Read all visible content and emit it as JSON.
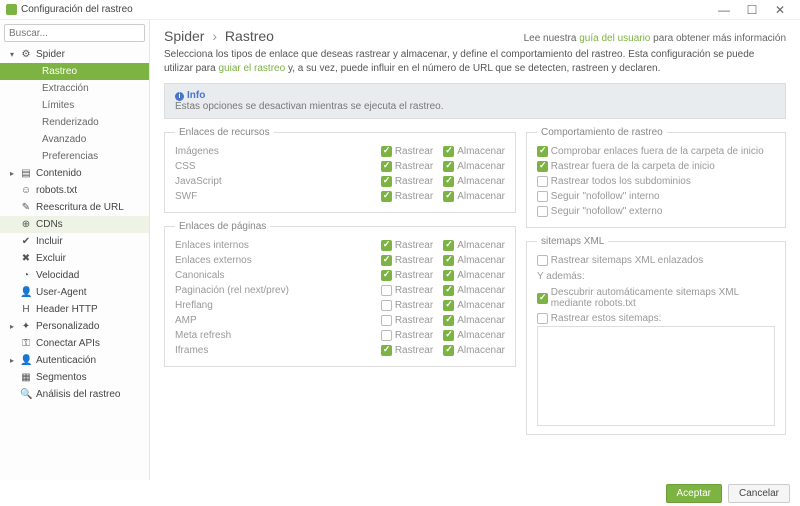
{
  "window": {
    "title": "Configuración del rastreo",
    "min": "—",
    "max": "☐",
    "close": "✕"
  },
  "search": {
    "placeholder": "Buscar..."
  },
  "sidebar": {
    "items": [
      {
        "label": "Spider"
      },
      {
        "label": "Rastreo"
      },
      {
        "label": "Extracción"
      },
      {
        "label": "Límites"
      },
      {
        "label": "Renderizado"
      },
      {
        "label": "Avanzado"
      },
      {
        "label": "Preferencias"
      },
      {
        "label": "Contenido"
      },
      {
        "label": "robots.txt"
      },
      {
        "label": "Reescritura de URL"
      },
      {
        "label": "CDNs"
      },
      {
        "label": "Incluir"
      },
      {
        "label": "Excluir"
      },
      {
        "label": "Velocidad"
      },
      {
        "label": "User-Agent"
      },
      {
        "label": "Header HTTP"
      },
      {
        "label": "Personalizado"
      },
      {
        "label": "Conectar APIs"
      },
      {
        "label": "Autenticación"
      },
      {
        "label": "Segmentos"
      },
      {
        "label": "Análisis del rastreo"
      }
    ]
  },
  "breadcrumb": {
    "root": "Spider",
    "current": "Rastreo",
    "sep": "›"
  },
  "help": {
    "prefix": "Lee nuestra ",
    "link": "guía del usuario",
    "suffix": " para obtener más información"
  },
  "intro": {
    "text1": "Selecciona los tipos de enlace que deseas rastrear y almacenar, y define el comportamiento del rastreo. Esta configuración se puede utilizar para ",
    "link": "guiar el rastreo",
    "text2": " y, a su vez, puede influir en el número de URL que se detecten, rastreen y declaren."
  },
  "info": {
    "title": "Info",
    "text": "Estas opciones se desactivan mientras se ejecuta el rastreo."
  },
  "labels": {
    "crawl": "Rastrear",
    "store": "Almacenar"
  },
  "groups": {
    "resources": {
      "legend": "Enlaces de recursos",
      "rows": [
        {
          "label": "Imágenes",
          "crawl": true,
          "store": true
        },
        {
          "label": "CSS",
          "crawl": true,
          "store": true
        },
        {
          "label": "JavaScript",
          "crawl": true,
          "store": true
        },
        {
          "label": "SWF",
          "crawl": true,
          "store": true
        }
      ]
    },
    "pages": {
      "legend": "Enlaces de páginas",
      "rows": [
        {
          "label": "Enlaces internos",
          "crawl": true,
          "store": true
        },
        {
          "label": "Enlaces externos",
          "crawl": true,
          "store": true
        },
        {
          "label": "Canonicals",
          "crawl": true,
          "store": true
        },
        {
          "label": "Paginación (rel next/prev)",
          "crawl": false,
          "store": true
        },
        {
          "label": "Hreflang",
          "crawl": false,
          "store": true
        },
        {
          "label": "AMP",
          "crawl": false,
          "store": true
        },
        {
          "label": "Meta refresh",
          "crawl": false,
          "store": true
        },
        {
          "label": "Iframes",
          "crawl": true,
          "store": true
        }
      ]
    },
    "behavior": {
      "legend": "Comportamiento de rastreo",
      "rows": [
        {
          "label": "Comprobar enlaces fuera de la carpeta de inicio",
          "checked": true
        },
        {
          "label": "Rastrear fuera de la carpeta de inicio",
          "checked": true
        },
        {
          "label": "Rastrear todos los subdominios",
          "checked": false
        },
        {
          "label": "Seguir \"nofollow\" interno",
          "checked": false
        },
        {
          "label": "Seguir \"nofollow\" externo",
          "checked": false
        }
      ]
    },
    "sitemaps": {
      "legend": "sitemaps XML",
      "row1": {
        "label": "Rastrear sitemaps XML enlazados",
        "checked": false
      },
      "also": "Y además:",
      "row2": {
        "label": "Descubrir automáticamente sitemaps XML mediante robots.txt",
        "checked": true
      },
      "row3": {
        "label": "Rastrear estos sitemaps:",
        "checked": false
      }
    }
  },
  "buttons": {
    "ok": "Aceptar",
    "cancel": "Cancelar"
  }
}
